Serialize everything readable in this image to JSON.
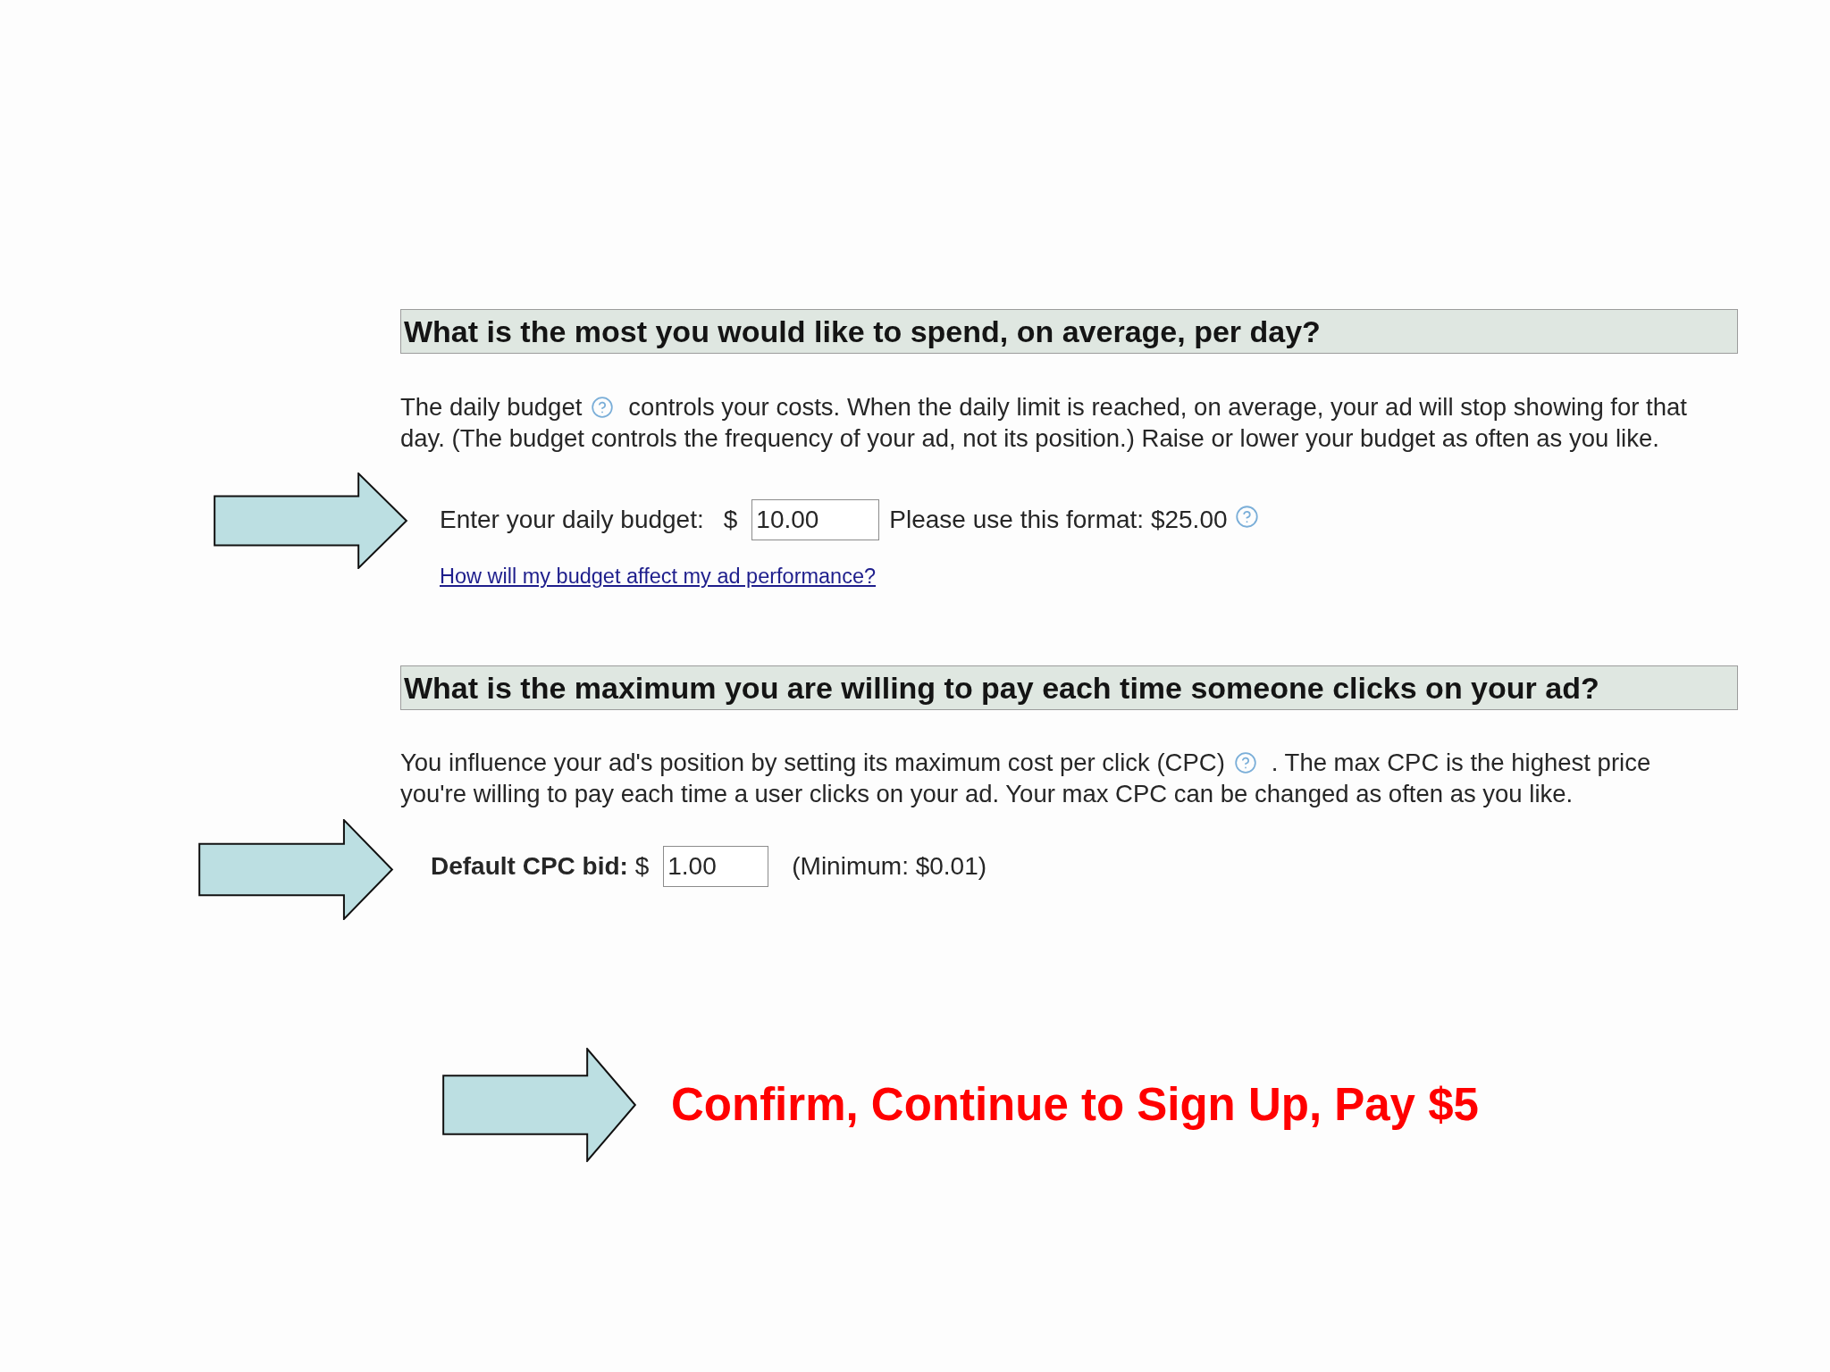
{
  "sections": [
    {
      "kind": "budget",
      "heading": "What is the most you would like to spend, on average, per day?",
      "description": {
        "line_1_before_help": "The daily budget",
        "line_1_after_help": "controls your costs. When the daily limit is reached, on average, your ad will stop showing for that",
        "line_2": "day. (The budget controls the frequency of your ad, not its position.) Raise or lower your budget as often as you like."
      },
      "field": {
        "label": "Enter your daily budget:",
        "currency": "$",
        "value": "10.00",
        "hint": "Please use this format: $25.00",
        "help_link": "How will my budget affect my ad performance?"
      }
    },
    {
      "kind": "bid",
      "heading": "What is the maximum you are willing to pay each time someone clicks on your ad?",
      "description": {
        "line_1_before_help": "You influence your ad's position by setting its maximum cost per click (CPC)",
        "line_1_after_help": ". The max CPC is the highest price",
        "line_2": "you're willing to pay each time a user clicks on your ad. Your max CPC can be changed as often as you like."
      },
      "field": {
        "label": "**Default CPC bid:** $",
        "value": "1.00",
        "hint": "(Minimum: $0.01)"
      }
    }
  ],
  "call_to_action": "Confirm, Continue to Sign Up, Pay $5"
}
